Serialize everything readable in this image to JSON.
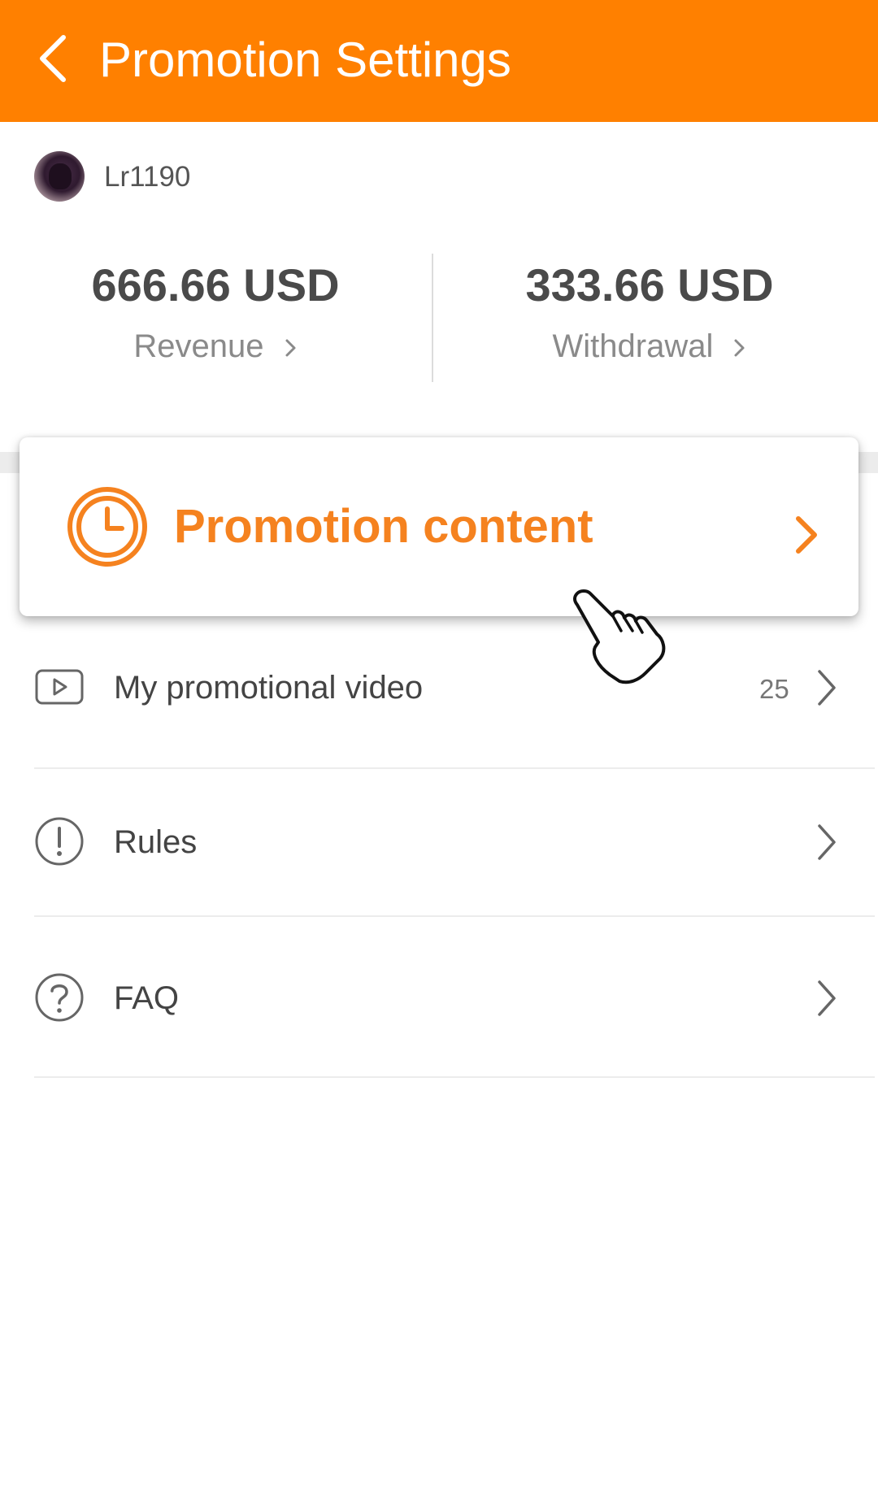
{
  "header": {
    "title": "Promotion Settings",
    "back_icon": "back-arrow-icon"
  },
  "user": {
    "name": "Lr1190"
  },
  "stats": {
    "revenue": {
      "amount": "666.66 USD",
      "label": "Revenue"
    },
    "withdrawal": {
      "amount": "333.66 USD",
      "label": "Withdrawal"
    }
  },
  "promotion_card": {
    "label": "Promotion content",
    "icon": "clock-icon"
  },
  "menu": {
    "video": {
      "label": "My promotional video",
      "count": "25",
      "icon": "video-play-icon"
    },
    "rules": {
      "label": "Rules",
      "icon": "exclamation-circle-icon"
    },
    "faq": {
      "label": "FAQ",
      "icon": "question-circle-icon"
    }
  },
  "colors": {
    "accent": "#ff8000",
    "promo_text": "#f5821f"
  }
}
